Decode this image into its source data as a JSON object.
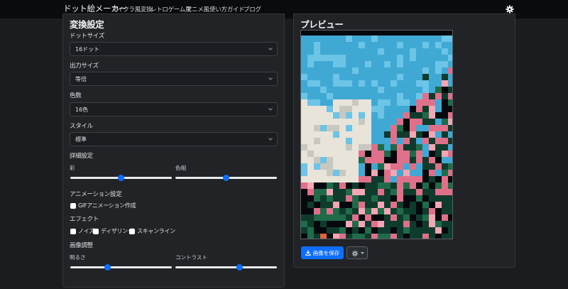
{
  "nav": {
    "brand": "ドット絵メーカー",
    "links": [
      "マイクラ風変換",
      "レトロゲーム風",
      "アニメ風",
      "使い方ガイド",
      "ブログ"
    ],
    "theme_icon": "gear-icon"
  },
  "settings": {
    "title": "変換設定",
    "dot_size": {
      "label": "ドットサイズ",
      "value": "16ドット"
    },
    "output_size": {
      "label": "出力サイズ",
      "value": "等倍"
    },
    "colors": {
      "label": "色数",
      "value": "16色"
    },
    "style": {
      "label": "スタイル",
      "value": "標準"
    },
    "detail": {
      "label": "詳細設定",
      "saturation": {
        "label": "彩",
        "value": 0.5
      },
      "hue": {
        "label": "色相",
        "value": 0.5
      }
    },
    "animation": {
      "label": "アニメーション設定",
      "gif_label": "GIFアニメーション作成"
    },
    "effects": {
      "label": "エフェクト",
      "noise": "ノイズ",
      "dithering": "ディザリング",
      "scanline": "スキャンライン"
    },
    "image_adjust": {
      "label": "画像調整",
      "brightness": {
        "label": "明るさ",
        "value": 0.37
      },
      "contrast": {
        "label": "コントラスト",
        "value": 0.63
      }
    }
  },
  "preview": {
    "title": "プレビュー",
    "save_label": "画像を保存",
    "save_icon": "download-icon",
    "menu_icon": "gear-icon",
    "palette": {
      "sky": "#3fa9d4",
      "sky_light": "#6cc4e6",
      "cloud": "#e8e4da",
      "cloud_shadow": "#c9c8c0",
      "pink": "#e0708a",
      "pink_light": "#f3a6b4",
      "green_dark": "#0f3b2c",
      "green": "#1f6b4a",
      "black": "#05090d",
      "orange": "#e0643a"
    }
  }
}
